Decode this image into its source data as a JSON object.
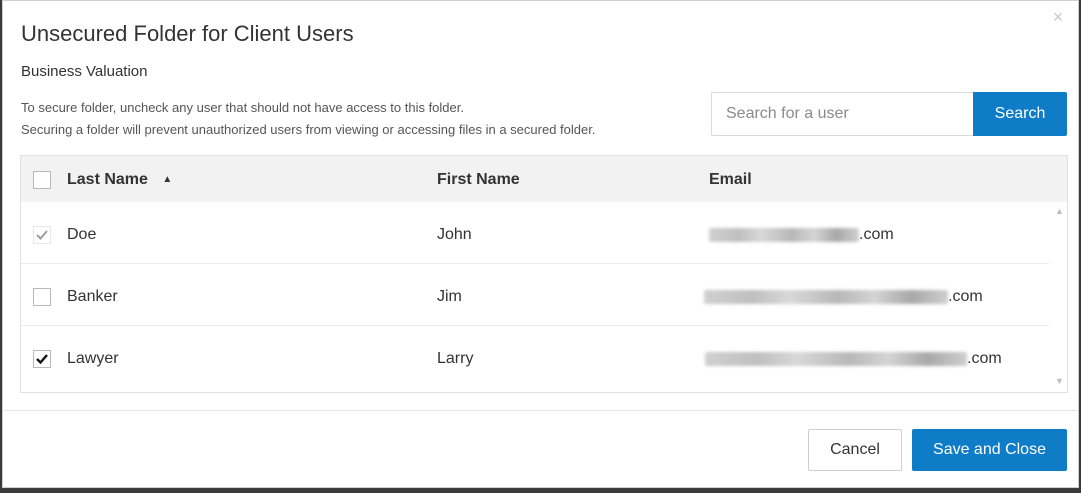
{
  "dialog": {
    "title": "Unsecured Folder for Client Users",
    "folder_name": "Business Valuation",
    "info_line1": "To secure folder, uncheck any user that should not have access to this folder.",
    "info_line2": "Securing a folder will prevent unauthorized users from viewing or accessing files in a secured folder.",
    "close_icon": "close-icon"
  },
  "search": {
    "placeholder": "Search for a user",
    "value": "",
    "button_label": "Search"
  },
  "table": {
    "columns": [
      "Last Name",
      "First Name",
      "Email"
    ],
    "sort_column": "Last Name",
    "sort_direction": "ascending",
    "select_all_checked": false,
    "rows": [
      {
        "last_name": "Doe",
        "first_name": "John",
        "email_suffix": ".com",
        "checked": true,
        "check_style": "light"
      },
      {
        "last_name": "Banker",
        "first_name": "Jim",
        "email_suffix": ".com",
        "checked": false,
        "check_style": "none"
      },
      {
        "last_name": "Lawyer",
        "first_name": "Larry",
        "email_suffix": ".com",
        "checked": true,
        "check_style": "dark"
      }
    ]
  },
  "footer": {
    "cancel_label": "Cancel",
    "save_label": "Save and Close"
  },
  "colors": {
    "accent": "#0e7cc7",
    "header_bg": "#f2f2f2"
  }
}
